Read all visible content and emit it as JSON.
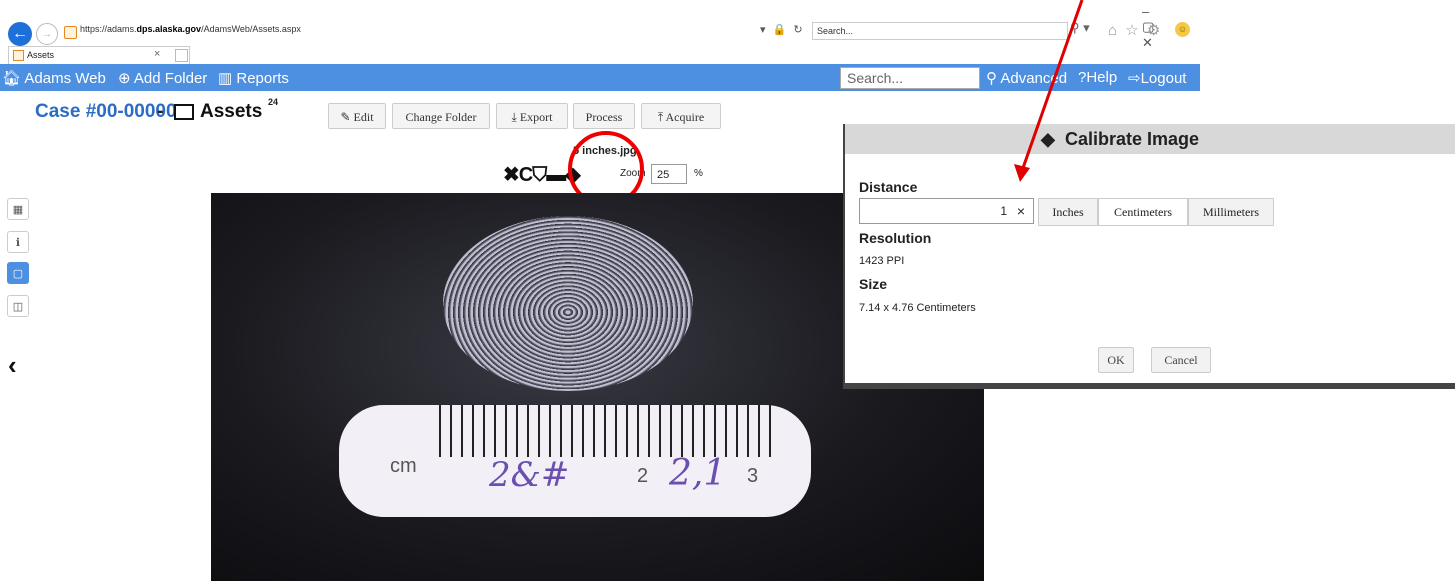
{
  "browser": {
    "url_prefix": "https://adams.",
    "url_domain": "dps.alaska.gov",
    "url_path": "/AdamsWeb/Assets.aspx",
    "search_placeholder": "Search...",
    "tab_title": "Assets",
    "back_icon": "back-arrow-icon",
    "addr_tools": "▾ 🔒 ↻",
    "search_tools": "⚲ ▾",
    "window_controls": "– ▢ ✕",
    "toolbar_icons": "⌂ ☆ ⚙"
  },
  "navbar": {
    "home": "Adams Web",
    "add_folder": "Add Folder",
    "reports": "Reports",
    "search_placeholder": "Search...",
    "advanced": "Advanced",
    "help": "Help",
    "logout": "Logout",
    "color": "#4d8fe0"
  },
  "header": {
    "case": "Case #00-00000",
    "dash": "-",
    "title": "Assets",
    "count": "24"
  },
  "toolbar": {
    "edit": "Edit",
    "change_folder": "Change Folder",
    "export": "Export",
    "process": "Process",
    "acquire": "Acquire"
  },
  "viewer": {
    "filename": "5 inches.jpg",
    "tools": "✖C⛉▬◆",
    "zoom_label": "Zoom",
    "zoom_value": "25",
    "zoom_unit": "%"
  },
  "photo_scale": {
    "unit": "cm",
    "tick_2": "2",
    "tick_3": "3",
    "handwriting_1": "2&#",
    "handwriting_2": "2,1"
  },
  "dialog": {
    "title": "Calibrate Image",
    "distance_label": "Distance",
    "distance_value": "1",
    "clear": "×",
    "units": [
      "Inches",
      "Centimeters",
      "Millimeters"
    ],
    "selected_unit": "Centimeters",
    "resolution_label": "Resolution",
    "resolution_value": "1423 PPI",
    "size_label": "Size",
    "size_value": "7.14 x 4.76 Centimeters",
    "ok": "OK",
    "cancel": "Cancel"
  },
  "annotation": {
    "arrow_color": "#e00000",
    "circle_color": "#e00000"
  }
}
